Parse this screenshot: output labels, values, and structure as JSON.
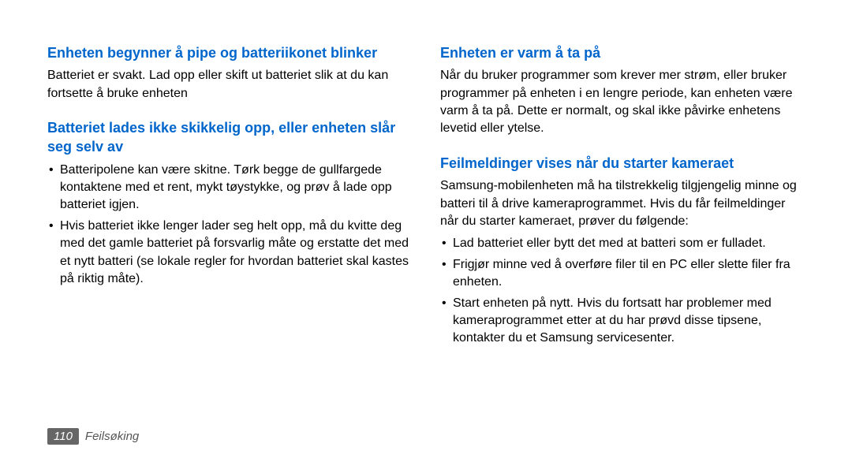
{
  "left": {
    "section1": {
      "heading": "Enheten begynner å pipe og batteriikonet blinker",
      "body": "Batteriet er svakt. Lad opp eller skift ut batteriet slik at du kan fortsette å bruke enheten"
    },
    "section2": {
      "heading": "Batteriet lades ikke skikkelig opp, eller enheten slår seg selv av",
      "bullets": [
        "Batteripolene kan være skitne. Tørk begge de gullfargede kontaktene med et rent, mykt tøystykke, og prøv å lade opp batteriet igjen.",
        "Hvis batteriet ikke lenger lader seg helt opp, må du kvitte deg med det gamle batteriet på forsvarlig måte og erstatte det med et nytt batteri (se lokale regler for hvordan batteriet skal kastes på riktig måte)."
      ]
    }
  },
  "right": {
    "section1": {
      "heading": "Enheten er varm å ta på",
      "body": "Når du bruker programmer som krever mer strøm, eller bruker programmer på enheten i en lengre periode, kan enheten være varm å ta på. Dette er normalt, og skal ikke påvirke enhetens levetid eller ytelse."
    },
    "section2": {
      "heading": "Feilmeldinger vises når du starter kameraet",
      "body": "Samsung-mobilenheten må ha tilstrekkelig tilgjengelig minne og batteri til å drive kameraprogrammet. Hvis du får feilmeldinger når du starter kameraet, prøver du følgende:",
      "bullets": [
        "Lad batteriet eller bytt det med at batteri som er fulladet.",
        "Frigjør minne ved å overføre filer til en PC eller slette filer fra enheten.",
        "Start enheten på nytt. Hvis du fortsatt har problemer med kameraprogrammet etter at du har prøvd disse tipsene, kontakter du et Samsung servicesenter."
      ]
    }
  },
  "footer": {
    "page": "110",
    "label": "Feilsøking"
  }
}
